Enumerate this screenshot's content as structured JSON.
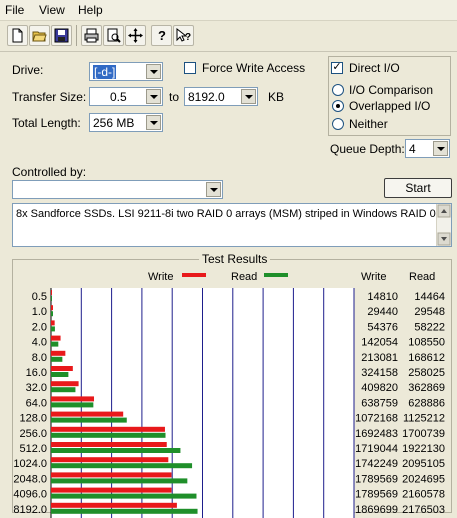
{
  "menu": [
    "File",
    "View",
    "Help"
  ],
  "toolbar_icons": [
    "new-file-icon",
    "open-folder-icon",
    "save-icon",
    "print-icon",
    "print-preview-icon",
    "move-icon",
    "help-icon",
    "context-help-icon"
  ],
  "form": {
    "drive_label": "Drive:",
    "drive_value": "[-d-]",
    "transfer_size_label": "Transfer Size:",
    "transfer_from": "0.5",
    "to_label": "to",
    "transfer_to": "8192.0",
    "kb_label": "KB",
    "total_length_label": "Total Length:",
    "total_length_value": "256 MB",
    "force_write_label": "Force Write Access",
    "force_write_checked": false,
    "direct_io_label": "Direct I/O",
    "direct_io_checked": true,
    "io_comparison_label": "I/O Comparison",
    "overlapped_io_label": "Overlapped I/O",
    "neither_label": "Neither",
    "selected_mode": "Overlapped I/O",
    "queue_depth_label": "Queue Depth:",
    "queue_depth_value": "4",
    "controlled_by_label": "Controlled by:",
    "controlled_by_value": "",
    "start_label": "Start",
    "description": "8x Sandforce SSDs. LSI 9211-8i two RAID 0 arrays (MSM) striped in Windows RAID 0."
  },
  "results": {
    "title": "Test Results",
    "write_legend": "Write",
    "read_legend": "Read",
    "write_col": "Write",
    "read_col": "Read"
  },
  "colors": {
    "write": "#e8191b",
    "read": "#1f8f2a",
    "grid": "#1e1e8c"
  },
  "chart_data": {
    "type": "bar",
    "orientation": "horizontal",
    "categories": [
      "0.5",
      "1.0",
      "2.0",
      "4.0",
      "8.0",
      "16.0",
      "32.0",
      "64.0",
      "128.0",
      "256.0",
      "512.0",
      "1024.0",
      "2048.0",
      "4096.0",
      "8192.0"
    ],
    "series": [
      {
        "name": "Write",
        "values": [
          14810,
          29440,
          54376,
          142054,
          213081,
          324158,
          409820,
          638759,
          1072168,
          1692483,
          1719044,
          1742249,
          1789569,
          1789569,
          1869699
        ]
      },
      {
        "name": "Read",
        "values": [
          14464,
          29548,
          58222,
          108550,
          168612,
          258025,
          362869,
          628886,
          1125212,
          1700739,
          1922130,
          2095105,
          2024695,
          2160578,
          2176503
        ]
      }
    ],
    "xlim": [
      0,
      4500000
    ],
    "grid": true
  }
}
